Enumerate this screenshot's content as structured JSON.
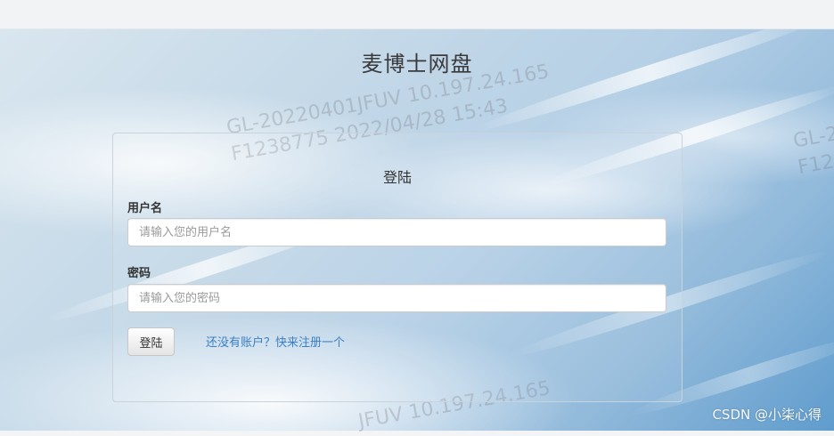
{
  "app_title": "麦博士网盘",
  "login": {
    "heading": "登陆",
    "username_label": "用户名",
    "username_placeholder": "请输入您的用户名",
    "password_label": "密码",
    "password_placeholder": "请输入您的密码",
    "submit_label": "登陆",
    "register_link": "还没有账户？快来注册一个"
  },
  "watermark": {
    "line1": "GL-20220401JFUV  10.197.24.165",
    "line2": "F1238775 2022/04/28 15:43",
    "right_line1": "GL-2",
    "right_line2": "F12",
    "bottom_line1": "JFUV  10.197.24.165"
  },
  "credit": "CSDN @小柒心得"
}
